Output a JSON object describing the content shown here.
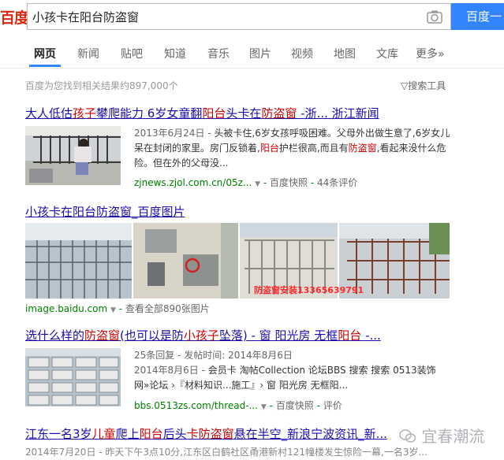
{
  "header": {
    "logo_text": "百度",
    "search_query": "小孩卡在阳台防盗窗",
    "search_button": "百度一下",
    "camera_icon": "camera-icon"
  },
  "tabs": [
    {
      "label": "网页",
      "active": true
    },
    {
      "label": "新闻"
    },
    {
      "label": "贴吧"
    },
    {
      "label": "知道"
    },
    {
      "label": "音乐"
    },
    {
      "label": "图片"
    },
    {
      "label": "视频"
    },
    {
      "label": "地图"
    },
    {
      "label": "文库"
    },
    {
      "label": "更多»"
    }
  ],
  "result_count": "百度为您找到相关结果约897,000个",
  "search_tools": "搜索工具",
  "results": [
    {
      "title_parts": [
        "大人低估",
        "孩子",
        "攀爬能力 6岁女童翻",
        "阳台",
        "头卡在",
        "防盗窗",
        " -浙... 浙江新闻"
      ],
      "date": "2013年6月24日 -",
      "snippet_parts": [
        " 头被卡住,6岁女孩呼吸困难。父母外出做生意了,6岁女儿呆在封闭的家里。房门反锁着,",
        "阳台",
        "护栏很高,而且有",
        "防盗窗",
        ",看起来没什么危险。但在外的父母没..."
      ],
      "url": "zjnews.zjol.com.cn/05z...",
      "links": [
        "百度快照",
        "44条评价"
      ]
    },
    {
      "title": "小孩卡在阳台防盗窗_百度图片",
      "url": "image.baidu.com",
      "link": "查看全部890张图片",
      "overlay_text": "防盗窗安装13365639791"
    },
    {
      "title_parts": [
        "选什么样的",
        "防盗窗",
        "(也可以是防",
        "小孩子",
        "坠落) - 窗 阳光房 无框",
        "阳台",
        " -..."
      ],
      "meta": "25条回复 - 发帖时间: 2014年8月6日",
      "date": "2014年8月6日 -",
      "snippet": " 会员卡 淘帖Collection 论坛BBS 搜索 搜索 0513装饰网»论坛 ›『材料知识...施工』› 窗 阳光房 无框阳...",
      "url": "bbs.0513zs.com/thread-...",
      "links": [
        "百度快照",
        "评价"
      ]
    },
    {
      "title_parts": [
        "江东一名3岁",
        "儿童",
        "爬上",
        "阳台",
        "后头",
        "卡",
        "防盗窗",
        "悬在半空_新浪宁波资讯_新..."
      ],
      "snippet": "2014年7月20日 - 昨天下午3点10分,江东区白鹤社区甬港新村121幢楼发生惊险一幕,一名3岁..."
    }
  ],
  "watermark": "宜春潮流",
  "colors": {
    "accent": "#3385ff",
    "link": "#1a0dab",
    "highlight": "#cc0000",
    "url_green": "#008000"
  }
}
